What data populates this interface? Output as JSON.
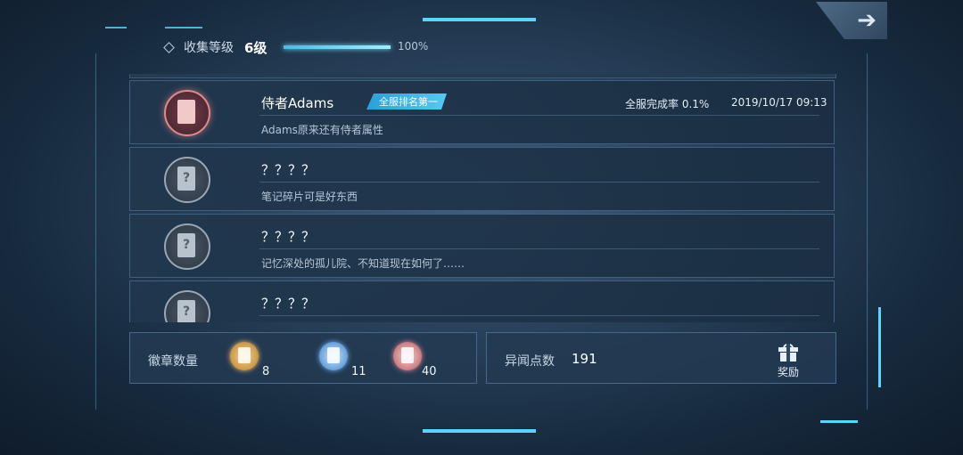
{
  "header": {
    "level_label": "收集等级",
    "level_value": "6级",
    "progress_percent": 100,
    "progress_text": "100%"
  },
  "colors": {
    "accent": "#5fd3ff",
    "tag_blue": "#3fb4e6"
  },
  "items": [
    {
      "title": "侍者Adams",
      "tag": "全服排名第一",
      "completion": "全服完成率 0.1%",
      "date": "2019/10/17 09:13",
      "desc": "Adams原来还有侍者属性",
      "unlocked": true
    },
    {
      "title": "？？？？",
      "desc": "笔记碎片可是好东西",
      "unlocked": false
    },
    {
      "title": "？？？？",
      "desc": "记忆深处的孤儿院、不知道现在如何了……",
      "unlocked": false
    },
    {
      "title": "？？？？",
      "desc": "",
      "unlocked": false
    }
  ],
  "badges": {
    "label": "徽章数量",
    "items": [
      {
        "icon": "gold-badge-icon",
        "count": "8"
      },
      {
        "icon": "blue-badge-icon",
        "count": "11"
      },
      {
        "icon": "pink-badge-icon",
        "count": "40"
      }
    ]
  },
  "points": {
    "label": "异闻点数",
    "value": "191"
  },
  "reward": {
    "label": "奖励",
    "icon": "gift-icon"
  }
}
